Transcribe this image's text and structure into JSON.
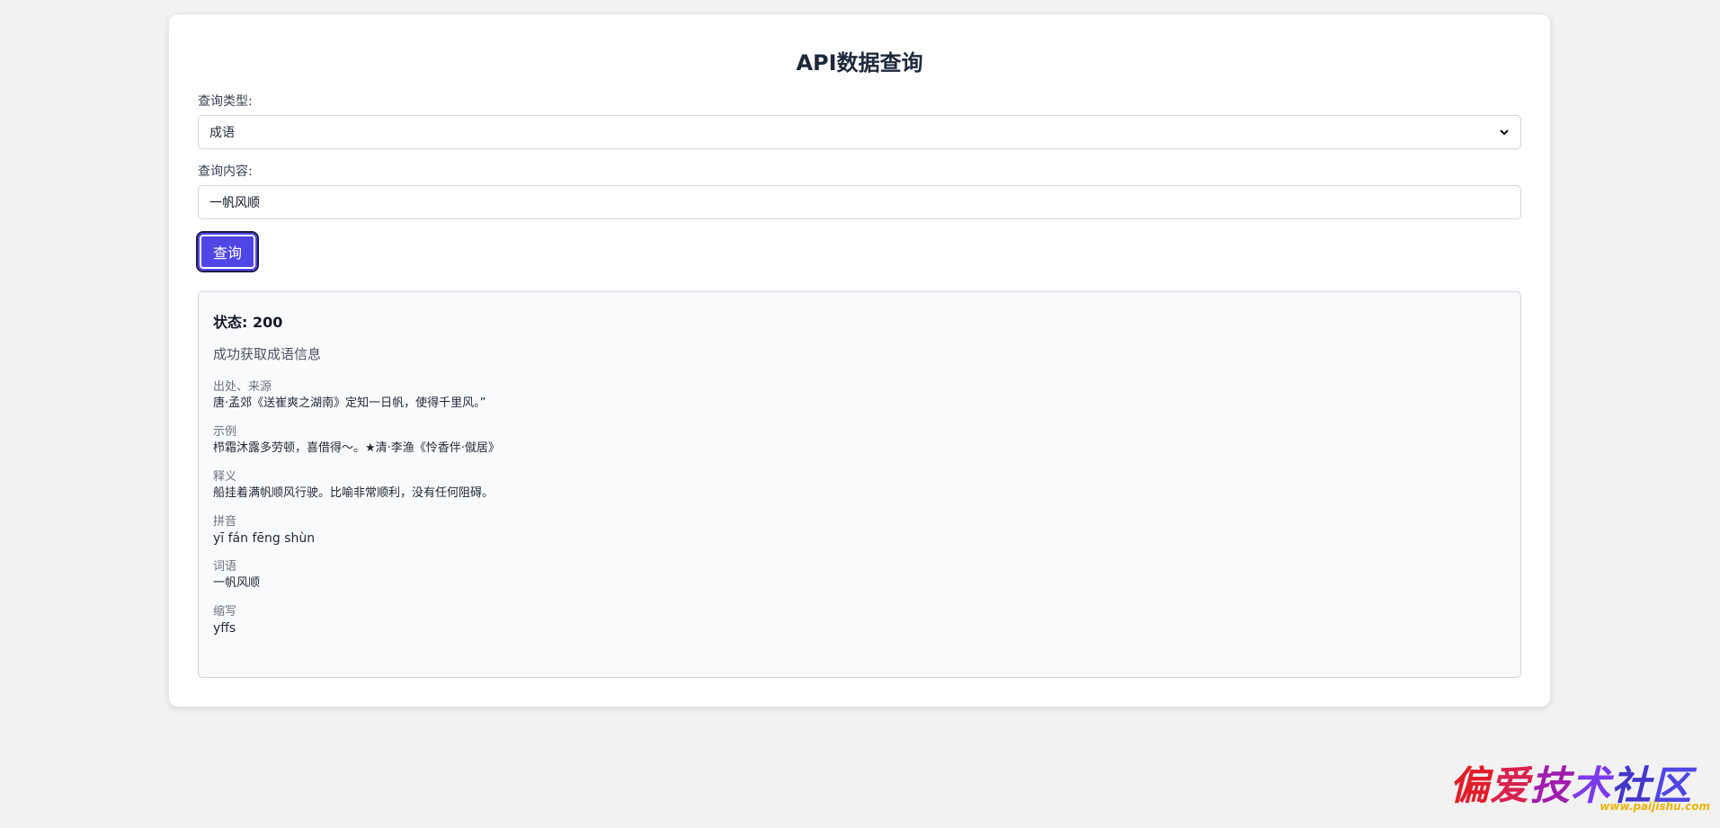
{
  "page": {
    "title": "API数据查询"
  },
  "form": {
    "type_label": "查询类型:",
    "type_selected": "成语",
    "content_label": "查询内容:",
    "content_value": "一帆风顺",
    "submit_label": "查询"
  },
  "result": {
    "status_text": "状态: 200",
    "message": "成功获取成语信息",
    "fields": [
      {
        "key": "出处、来源",
        "value": "唐·孟郊《送崔爽之湖南》定知一日帆，使得千里风。”"
      },
      {
        "key": "示例",
        "value": "栉霜沐露多劳顿，喜借得～。★清·李渔《怜香伴·僦居》"
      },
      {
        "key": "释义",
        "value": "船挂着满帆顺风行驶。比喻非常顺利，没有任何阻碍。"
      },
      {
        "key": "拼音",
        "value": "yī fán fēng shùn"
      },
      {
        "key": "词语",
        "value": "一帆风顺"
      },
      {
        "key": "缩写",
        "value": "yffs"
      }
    ]
  },
  "watermark": {
    "chars": [
      "偏",
      "爱",
      "技",
      "术",
      "社",
      "区"
    ],
    "url": "www.paijishu.com"
  },
  "icons": {
    "select_arrow": "chevron-down-icon"
  }
}
